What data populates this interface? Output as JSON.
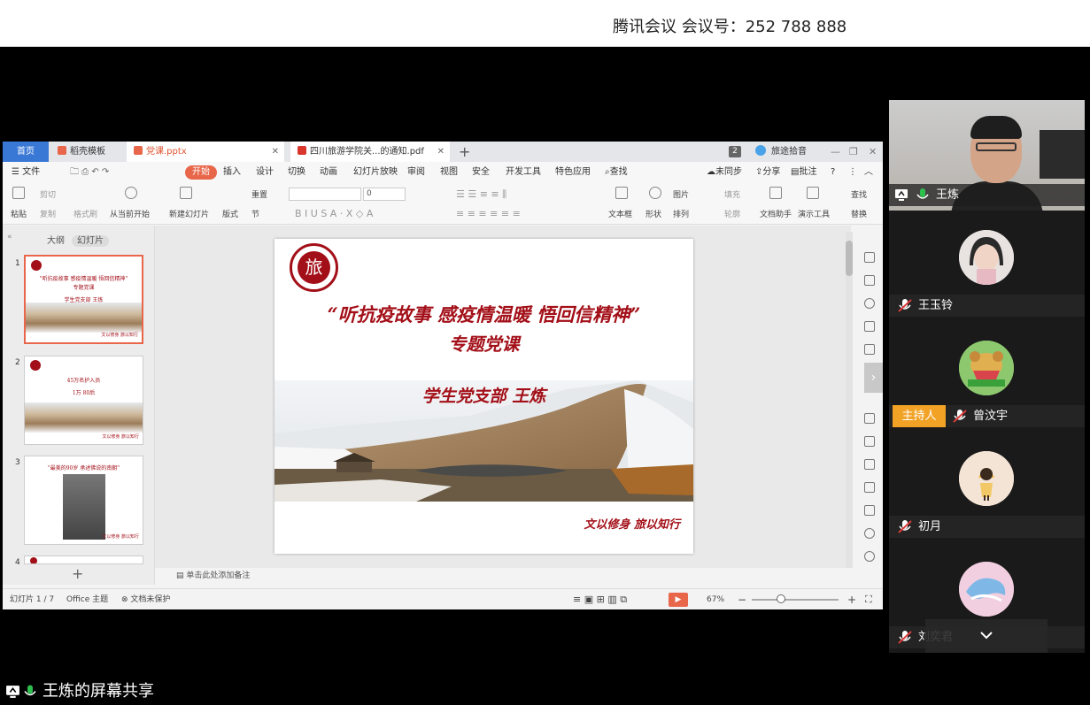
{
  "meeting": {
    "title": "腾讯会议 会议号：252 788 888"
  },
  "share": {
    "label": "王炼的屏幕共享"
  },
  "wps": {
    "tabs": [
      {
        "label": "首页"
      },
      {
        "label": "稻壳模板"
      },
      {
        "label": "党课.pptx"
      },
      {
        "label": "四川旅游学院关...的通知.pdf"
      }
    ],
    "page_badge": "2",
    "user": "旅途拾音",
    "menu": [
      "文件",
      "开始",
      "插入",
      "设计",
      "切换",
      "动画",
      "幻灯片放映",
      "审阅",
      "视图",
      "安全",
      "开发工具",
      "特色应用",
      "查找"
    ],
    "menu_right": [
      "未同步",
      "分享",
      "批注"
    ],
    "ribbon": {
      "paste": "粘贴",
      "cut": "剪切",
      "copy": "复制",
      "format_painter": "格式刷",
      "play_from_start": "从当前开始",
      "new_slide": "新建幻灯片",
      "layout": "版式",
      "reset": "重置",
      "section": "节",
      "font_size": "0",
      "textbox": "文本框",
      "shape": "形状",
      "picture": "图片",
      "arrange": "排列",
      "fill": "填充",
      "outline": "轮廓",
      "doc_helper": "文档助手",
      "present_tools": "演示工具",
      "find": "查找",
      "replace": "替换"
    },
    "panel_tabs": [
      "大纲",
      "幻灯片"
    ],
    "thumbs": [
      {
        "num": "1",
        "line1": "\"听抗疫故事 感疫情温暖 悟回信精神\"",
        "line2": "专题党课",
        "line3": "学生党支部 王炼",
        "foot": "文以修身 旅以知行"
      },
      {
        "num": "2",
        "line1": "45万名护入员",
        "line2": "1万 80后",
        "line3": "",
        "foot": "文以修身 旅以知行"
      },
      {
        "num": "3",
        "line1": "\"最美的90岁 承述佛说的南朝\"",
        "line2": "",
        "line3": "",
        "foot": "文以修身 旅以知行"
      },
      {
        "num": "4"
      }
    ],
    "slide": {
      "title_line1": "“听抗疫故事 感疫情温暖 悟回信精神”",
      "title_line2": "专题党课",
      "author": "学生党支部 王炼",
      "motto": "文以修身 旅以知行",
      "logo_char": "旅"
    },
    "notes_placeholder": "单击此处添加备注",
    "status": {
      "slide_count": "幻灯片 1 / 7",
      "theme": "Office 主题",
      "protect": "文档未保护",
      "zoom": "67%"
    }
  },
  "participants": [
    {
      "name": "王炼",
      "camera": true,
      "mic": "on"
    },
    {
      "name": "王玉铃",
      "camera": false,
      "mic": "off"
    },
    {
      "name": "曾汶宇",
      "camera": false,
      "mic": "off",
      "host_label": "主持人"
    },
    {
      "name": "初月",
      "camera": false,
      "mic": "off"
    },
    {
      "name": "刘奕君",
      "camera": false,
      "mic": "off"
    }
  ],
  "colors": {
    "accent": "#e8664a",
    "slide_red": "#a30f18",
    "host": "#f2a326",
    "mic_green": "#2dbf4e"
  }
}
